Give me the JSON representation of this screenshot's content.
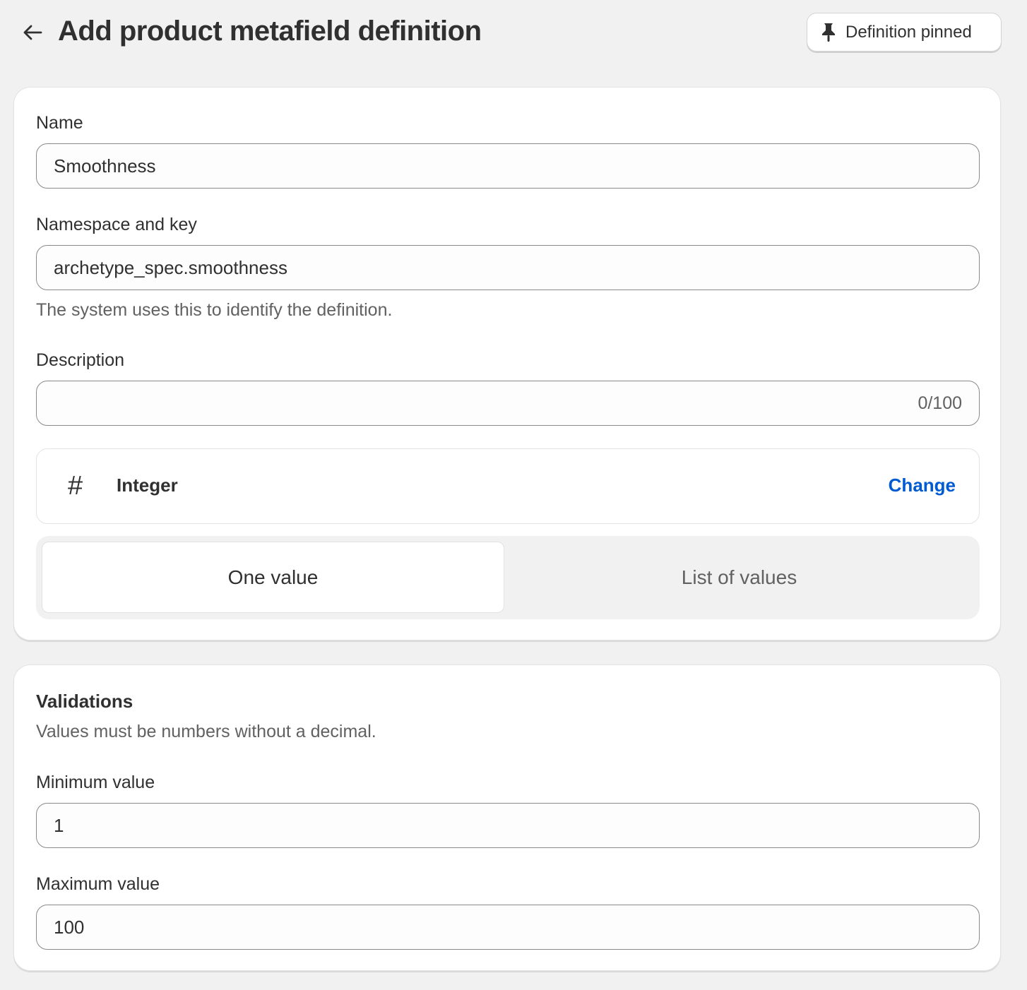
{
  "header": {
    "title": "Add product metafield definition",
    "pin_button_label": "Definition pinned"
  },
  "definition": {
    "name_label": "Name",
    "name_value": "Smoothness",
    "namespace_label": "Namespace and key",
    "namespace_value": "archetype_spec.smoothness",
    "namespace_help": "The system uses this to identify the definition.",
    "description_label": "Description",
    "description_value": "",
    "description_counter": "0/100",
    "type_symbol": "#",
    "type_name": "Integer",
    "change_label": "Change",
    "one_value_label": "One value",
    "list_values_label": "List of values",
    "selected_option": "One value"
  },
  "validations": {
    "title": "Validations",
    "help": "Values must be numbers without a decimal.",
    "min_label": "Minimum value",
    "min_value": "1",
    "max_label": "Maximum value",
    "max_value": "100"
  },
  "icons": {
    "back": "arrow-left-icon",
    "pin": "pin-icon"
  },
  "colors": {
    "link": "#005bd3",
    "background": "#f1f1f1"
  }
}
